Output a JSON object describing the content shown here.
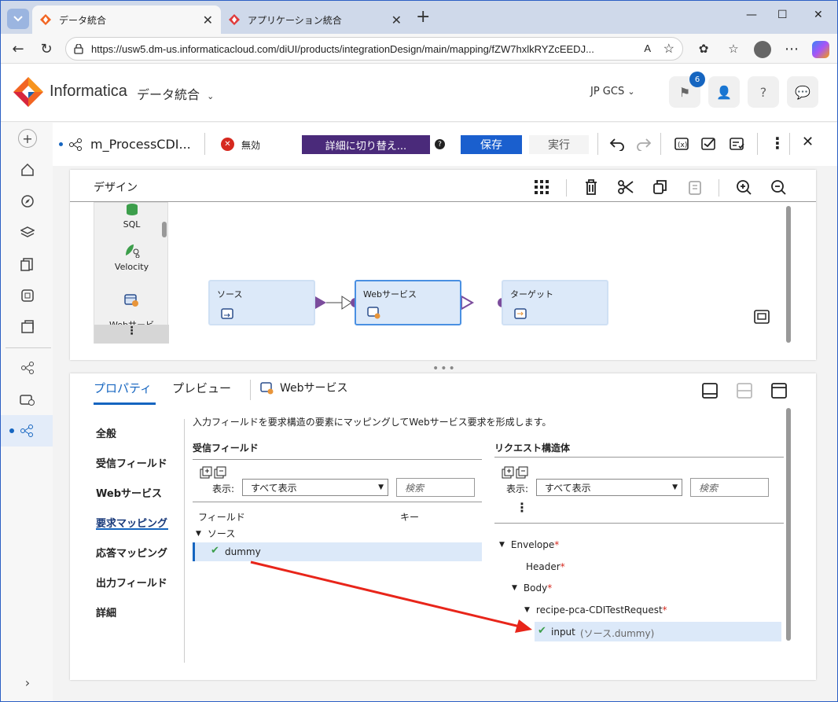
{
  "browser": {
    "tabs": [
      {
        "label": "データ統合"
      },
      {
        "label": "アプリケーション統合"
      }
    ],
    "url": "https://usw5.dm-us.informaticacloud.com/diUI/products/integrationDesign/main/mapping/fZW7hxlkRYZcEEDJ...",
    "new_tab": "+",
    "controls": {
      "minimize": "—",
      "maximize": "☐",
      "close": "✕"
    }
  },
  "app": {
    "brand": "Informatica",
    "product": "データ統合",
    "org": "JP GCS",
    "notification_count": "6"
  },
  "toolbar": {
    "mapping_name": "m_ProcessCDI...",
    "status": "無効",
    "switch_label": "詳細に切り替え...",
    "save_label": "保存",
    "run_label": "実行"
  },
  "design": {
    "title": "デザイン",
    "palette": [
      {
        "label": "SQL"
      },
      {
        "label": "Velocity"
      },
      {
        "label": "Webサービ\nス"
      }
    ],
    "nodes": [
      {
        "label": "ソース"
      },
      {
        "label": "Webサービス"
      },
      {
        "label": "ターゲット"
      }
    ]
  },
  "properties": {
    "tabs": {
      "props": "プロパティ",
      "preview": "プレビュー",
      "object": "Webサービス"
    },
    "nav": [
      "全般",
      "受信フィールド",
      "Webサービス",
      "要求マッピング",
      "応答マッピング",
      "出力フィールド",
      "詳細"
    ],
    "description": "入力フィールドを要求構造の要素にマッピングしてWebサービス要求を形成します。",
    "incoming": {
      "title": "受信フィールド",
      "show_label": "表示:",
      "show_value": "すべて表示",
      "search_placeholder": "検索",
      "col_field": "フィールド",
      "col_key": "キー",
      "group": "ソース",
      "field": "dummy"
    },
    "request": {
      "title": "リクエスト構造体",
      "show_label": "表示:",
      "show_value": "すべて表示",
      "search_placeholder": "検索",
      "tree": [
        {
          "label": "Envelope"
        },
        {
          "label": "Header"
        },
        {
          "label": "Body"
        },
        {
          "label": "recipe-pca-CDITestRequest"
        },
        {
          "label": "input",
          "mapped": "(ソース.dummy)"
        }
      ]
    }
  },
  "colors": {
    "accent": "#1565c0",
    "save": "#1a5fce",
    "switch": "#4a2a7a",
    "node": "#dce9f9",
    "arrow": "#e8251a"
  }
}
